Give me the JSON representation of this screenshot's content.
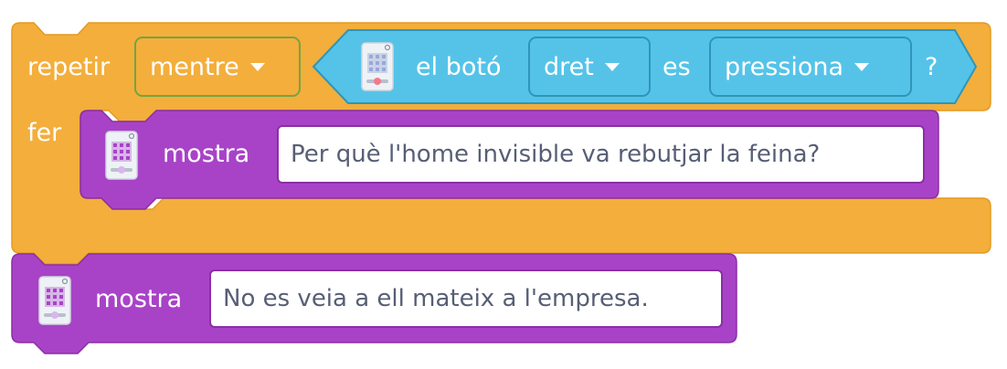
{
  "repeat_block": {
    "label": "repetir",
    "mode": "mentre",
    "do_label": "fer",
    "color": "#f3ae3c"
  },
  "condition": {
    "prefix": "el botó",
    "button": "dret",
    "connector": "es",
    "state": "pressiona",
    "suffix": "?",
    "color": "#55c3e8",
    "icon": "device-icon"
  },
  "show_block_1": {
    "label": "mostra",
    "text": "Per què l'home invisible va rebutjar la feina?",
    "color": "#a843c7",
    "icon": "device-icon"
  },
  "show_block_2": {
    "label": "mostra",
    "text": "No es veia a ell mateix a l'empresa.",
    "color": "#a843c7",
    "icon": "device-icon"
  }
}
